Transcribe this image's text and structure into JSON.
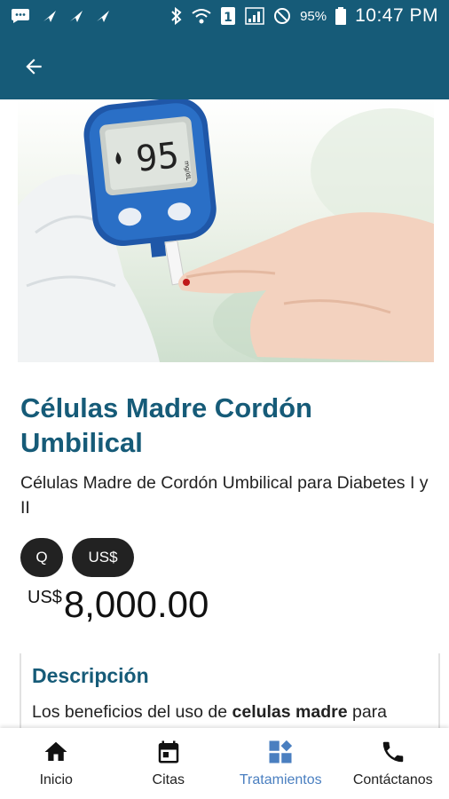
{
  "status_bar": {
    "battery": "95%",
    "time": "10:47 PM"
  },
  "app_bar": {
    "back_icon": "arrow-back-icon"
  },
  "hero": {
    "meter_reading": "95",
    "meter_unit": "mg/dL"
  },
  "product": {
    "title": "Células Madre Cordón Umbilical",
    "subtitle": "Células Madre de Cordón Umbilical para Diabetes I y II",
    "currency_options": [
      "Q",
      "US$"
    ],
    "price_prefix": "US$",
    "price_value": "8,000.00"
  },
  "description": {
    "heading": "Descripción",
    "text_start": "Los beneficios del uso de ",
    "text_bold": "celulas madre",
    "text_end": " para"
  },
  "bottom_nav": {
    "items": [
      {
        "label": "Inicio",
        "icon": "home-icon"
      },
      {
        "label": "Citas",
        "icon": "calendar-icon"
      },
      {
        "label": "Tratamientos",
        "icon": "dashboard-icon"
      },
      {
        "label": "Contáctanos",
        "icon": "phone-icon"
      }
    ],
    "active_index": 2,
    "active_color": "#4a7fc0"
  },
  "colors": {
    "primary": "#165b78",
    "text": "#222222"
  }
}
